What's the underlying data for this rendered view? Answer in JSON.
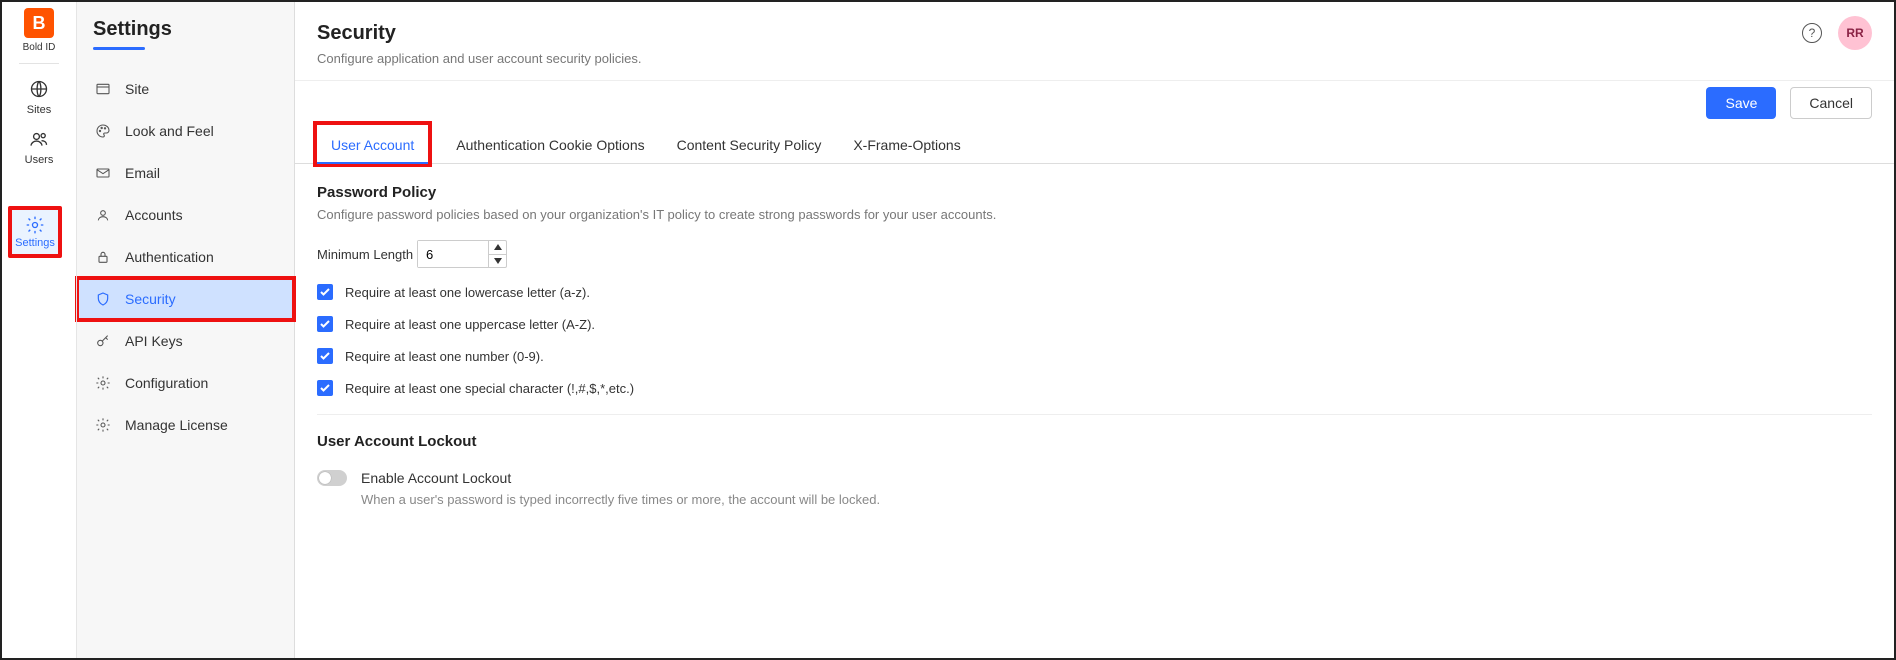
{
  "rail": {
    "brand": "Bold ID",
    "items": [
      {
        "label": "Sites"
      },
      {
        "label": "Users"
      },
      {
        "label": "Settings"
      }
    ],
    "selectedIndex": 2
  },
  "sidebar": {
    "title": "Settings",
    "items": [
      {
        "label": "Site",
        "icon": "site-icon"
      },
      {
        "label": "Look and Feel",
        "icon": "palette-icon"
      },
      {
        "label": "Email",
        "icon": "mail-icon"
      },
      {
        "label": "Accounts",
        "icon": "account-icon"
      },
      {
        "label": "Authentication",
        "icon": "lock-icon"
      },
      {
        "label": "Security",
        "icon": "shield-icon"
      },
      {
        "label": "API Keys",
        "icon": "key-icon"
      },
      {
        "label": "Configuration",
        "icon": "gear-icon"
      },
      {
        "label": "Manage License",
        "icon": "gear-icon"
      }
    ],
    "activeIndex": 5
  },
  "page": {
    "title": "Security",
    "subtitle": "Configure application and user account security policies.",
    "save": "Save",
    "cancel": "Cancel",
    "avatar": "RR"
  },
  "tabs": {
    "items": [
      "User Account",
      "Authentication Cookie Options",
      "Content Security Policy",
      "X-Frame-Options"
    ],
    "activeIndex": 0
  },
  "passwordPolicy": {
    "heading": "Password Policy",
    "desc": "Configure password policies based on your organization's IT policy to create strong passwords for your user accounts.",
    "minLabel": "Minimum Length",
    "minValue": "6",
    "checks": [
      {
        "label": "Require at least one lowercase letter (a-z).",
        "checked": true
      },
      {
        "label": "Require at least one uppercase letter (A-Z).",
        "checked": true
      },
      {
        "label": "Require at least one number (0-9).",
        "checked": true
      },
      {
        "label": "Require at least one special character (!,#,$,*,etc.)",
        "checked": true
      }
    ]
  },
  "lockout": {
    "heading": "User Account Lockout",
    "toggleLabel": "Enable Account Lockout",
    "toggleOn": false,
    "desc": "When a user's password is typed incorrectly five times or more, the account will be locked."
  },
  "colors": {
    "accent": "#2b6cff",
    "highlight": "#e11"
  }
}
